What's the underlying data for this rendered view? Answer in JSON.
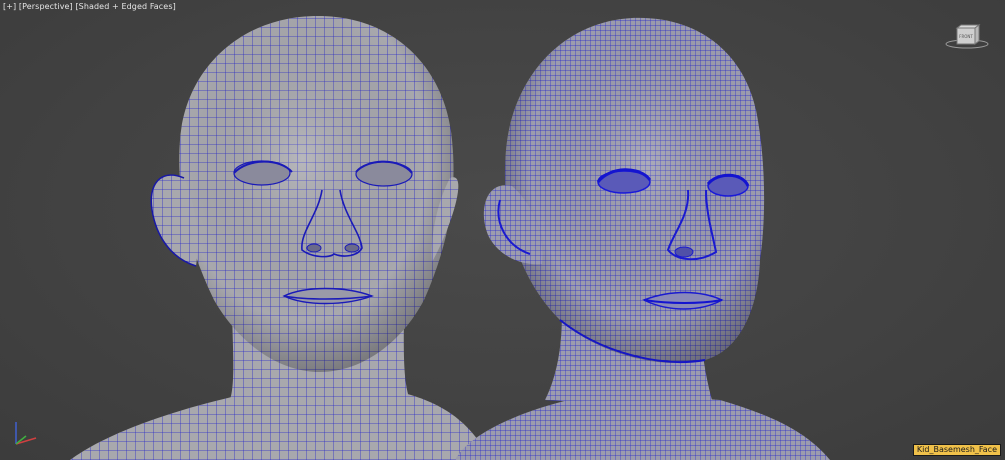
{
  "viewport": {
    "labels": [
      "[+]",
      "[Perspective]",
      "[Shaded + Edged Faces]"
    ],
    "selected_object": "Kid_Basemesh_Face",
    "viewcube_face": "FRONT"
  },
  "colors": {
    "background": "#444444",
    "mesh_fill": "#a9a9ad",
    "wire": "#2222cc",
    "selection_tag": "#f0c14a"
  },
  "icons": [
    "viewcube-icon",
    "axis-tripod-icon"
  ]
}
